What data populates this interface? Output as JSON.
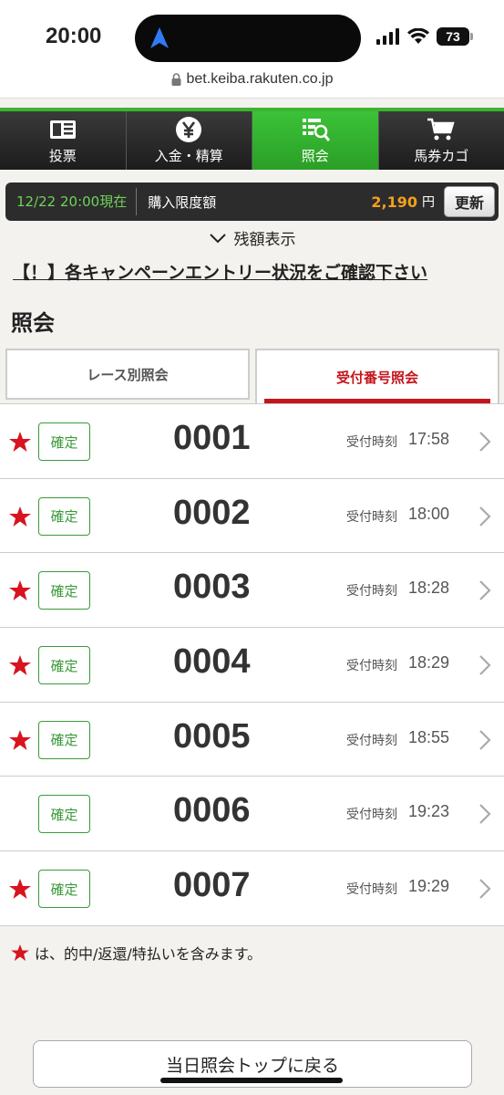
{
  "status": {
    "time": "20:00",
    "battery": "73"
  },
  "browser": {
    "url": "bet.keiba.rakuten.co.jp"
  },
  "nav": [
    {
      "label": "投票",
      "icon": "ticket-icon"
    },
    {
      "label": "入金・精算",
      "icon": "yen-icon"
    },
    {
      "label": "照会",
      "icon": "inquiry-icon"
    },
    {
      "label": "馬券カゴ",
      "icon": "cart-icon"
    }
  ],
  "info": {
    "datetime": "12/22 20:00現在",
    "limit_label": "購入限度額",
    "limit_amount": "2,190",
    "currency": "円",
    "refresh_label": "更新"
  },
  "balance_toggle": "残額表示",
  "campaign_link": "【！】各キャンペーンエントリー状況をご確認下さい",
  "section_title": "照会",
  "tabs": {
    "by_race": "レース別照会",
    "by_number": "受付番号照会"
  },
  "row_label": "受付時刻",
  "rows": [
    {
      "star": true,
      "status": "確定",
      "number": "0001",
      "time": "17:58"
    },
    {
      "star": true,
      "status": "確定",
      "number": "0002",
      "time": "18:00"
    },
    {
      "star": true,
      "status": "確定",
      "number": "0003",
      "time": "18:28"
    },
    {
      "star": true,
      "status": "確定",
      "number": "0004",
      "time": "18:29"
    },
    {
      "star": true,
      "status": "確定",
      "number": "0005",
      "time": "18:55"
    },
    {
      "star": false,
      "status": "確定",
      "number": "0006",
      "time": "19:23"
    },
    {
      "star": true,
      "status": "確定",
      "number": "0007",
      "time": "19:29"
    }
  ],
  "legend_note": "は、的中/返還/特払いを含みます。",
  "back_button": "当日照会トップに戻る",
  "colors": {
    "green": "#3bb52f",
    "red": "#c4151c",
    "orange": "#f3a11b"
  }
}
